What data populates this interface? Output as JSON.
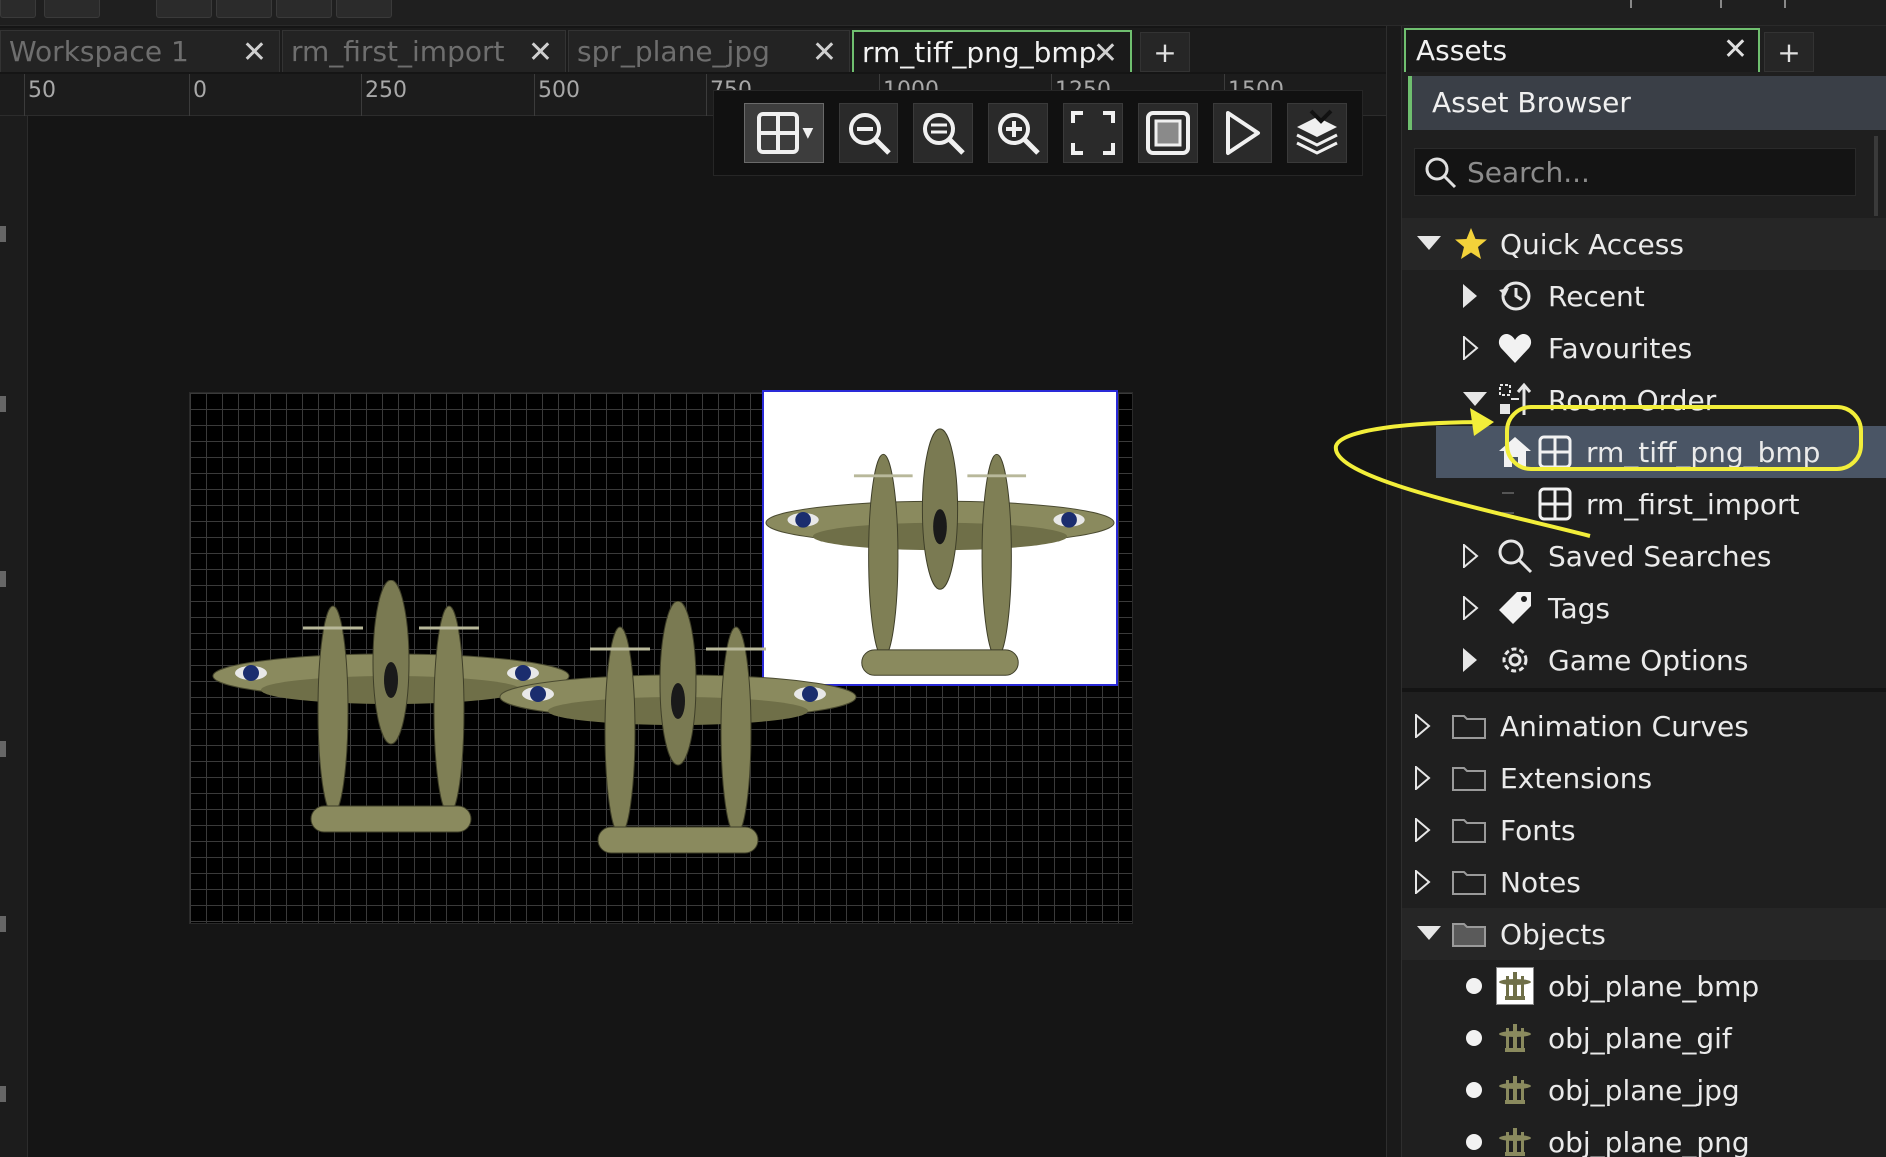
{
  "tabs": [
    {
      "label": "Workspace 1",
      "active": false
    },
    {
      "label": "rm_first_import",
      "active": false
    },
    {
      "label": "spr_plane_jpg",
      "active": false
    },
    {
      "label": "rm_tiff_png_bmp",
      "active": true
    }
  ],
  "tab_close": "✕",
  "tab_add": "+",
  "ruler": {
    "labels": [
      "50",
      "0",
      "250",
      "500",
      "750",
      "1000",
      "1250",
      "1500"
    ]
  },
  "toolbar": {
    "grid_tooltip": "Grid",
    "items": [
      "grid-toggle",
      "zoom-out",
      "zoom-reset",
      "zoom-in",
      "fit-view",
      "center-view",
      "play-room",
      "layers"
    ]
  },
  "assets_panel": {
    "tab_label": "Assets",
    "close": "✕",
    "add": "+",
    "title": "Asset Browser",
    "search_placeholder": "Search...",
    "quick_access": {
      "label": "Quick Access",
      "items": [
        {
          "label": "Recent",
          "icon": "history-icon",
          "expanded": false
        },
        {
          "label": "Favourites",
          "icon": "heart-icon",
          "expanded": false
        },
        {
          "label": "Room Order",
          "icon": "room-order-icon",
          "expanded": true,
          "children": [
            "rm_tiff_png_bmp",
            "rm_first_import"
          ]
        },
        {
          "label": "Saved Searches",
          "icon": "search-icon",
          "expanded": false
        },
        {
          "label": "Tags",
          "icon": "tag-icon",
          "expanded": false
        },
        {
          "label": "Game Options",
          "icon": "gear-icon",
          "expanded": false
        }
      ]
    },
    "folders": [
      "Animation Curves",
      "Extensions",
      "Fonts",
      "Notes"
    ],
    "objects": {
      "label": "Objects",
      "items": [
        "obj_plane_bmp",
        "obj_plane_gif",
        "obj_plane_jpg",
        "obj_plane_png"
      ]
    }
  },
  "colors": {
    "accent": "#6fbf6f",
    "annotation": "#f2ee3a",
    "selection": "#4a5565"
  }
}
